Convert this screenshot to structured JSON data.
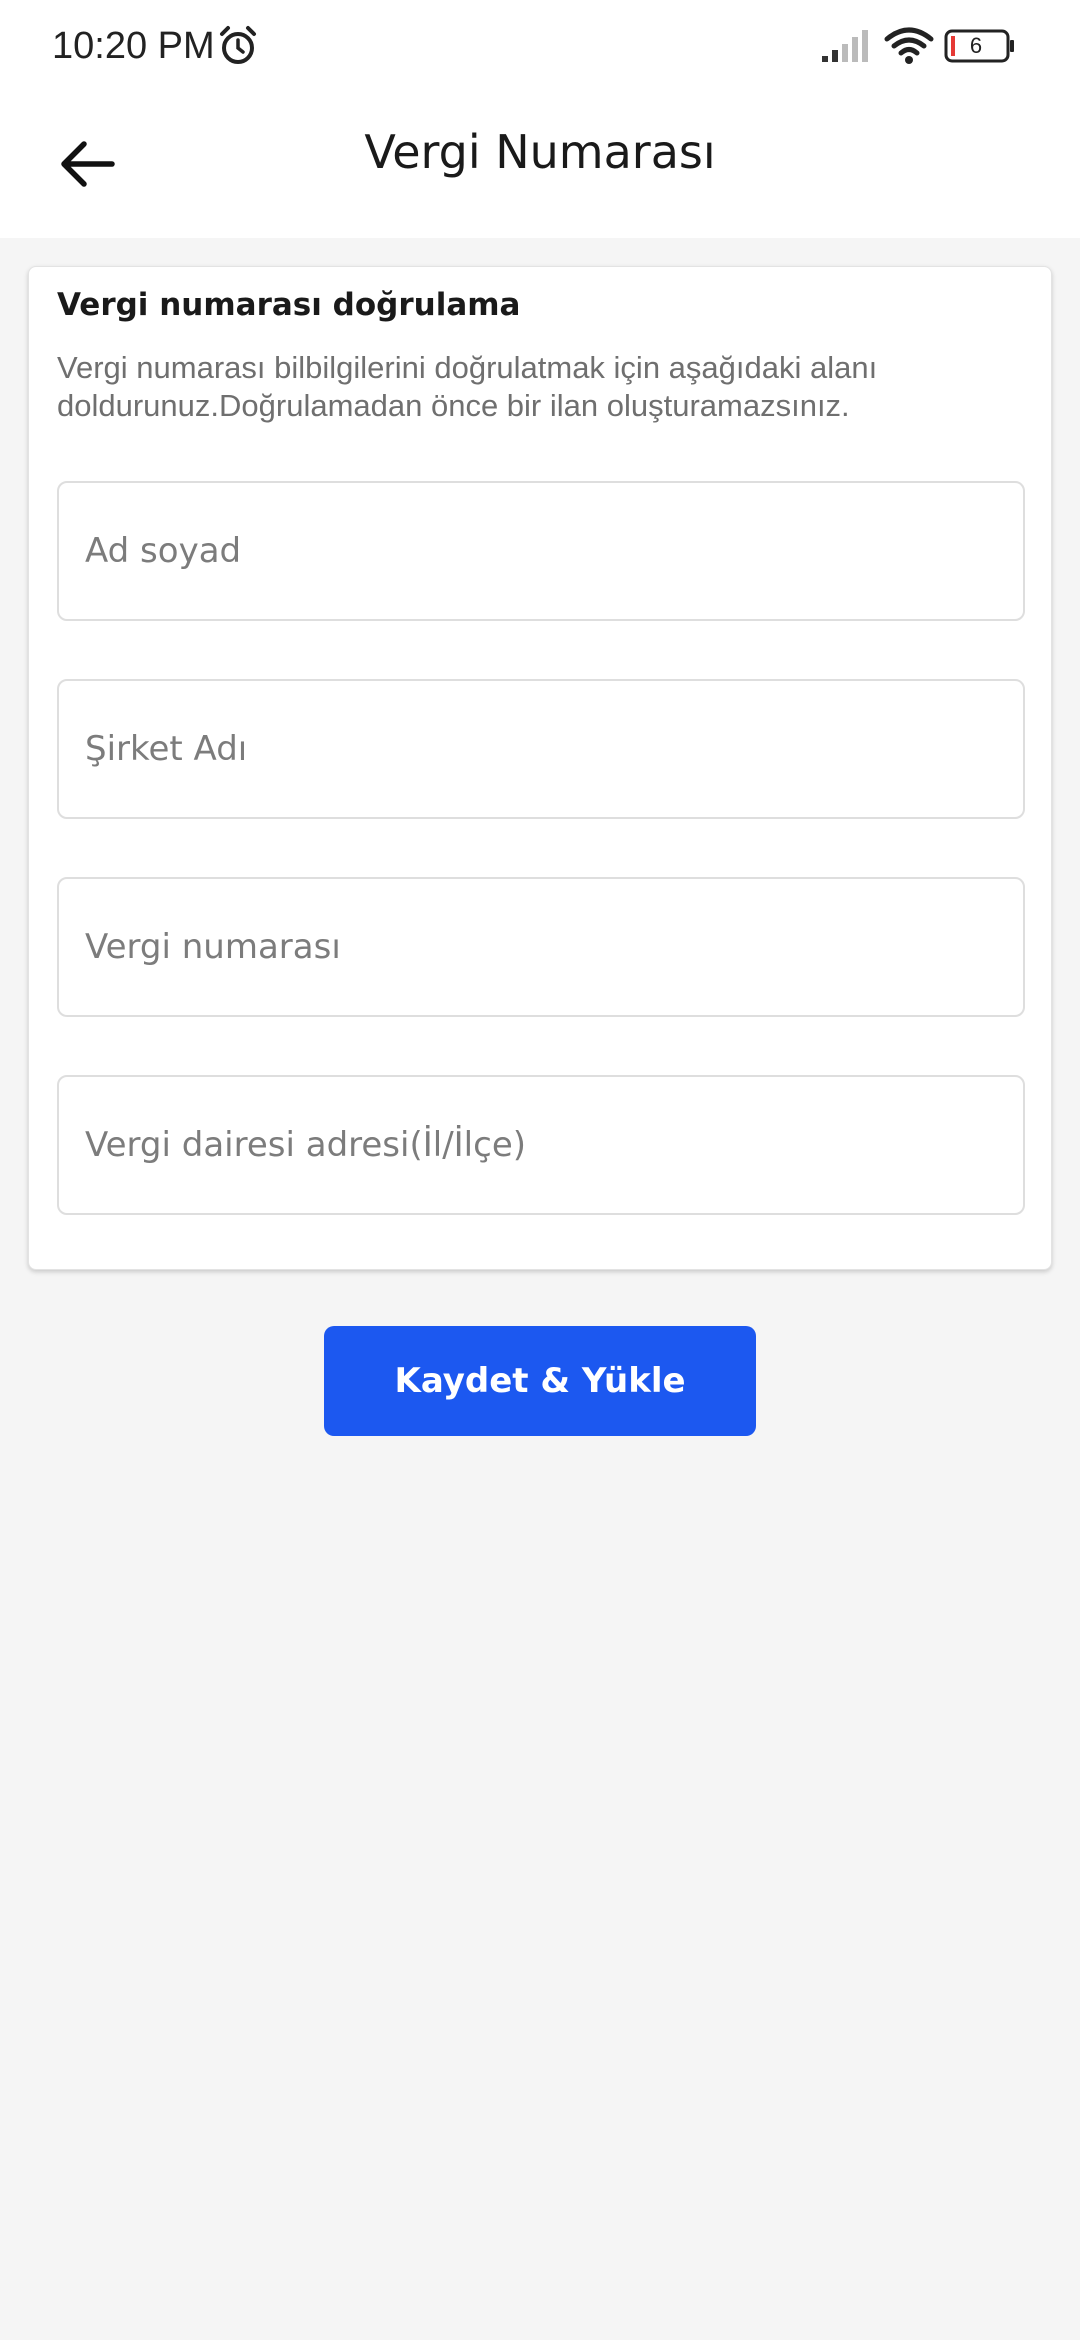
{
  "status_bar": {
    "time": "10:20 PM",
    "battery_level": "6",
    "icons": [
      "alarm-icon",
      "signal-icon",
      "wifi-icon",
      "battery-icon"
    ]
  },
  "header": {
    "title": "Vergi Numarası",
    "back_icon": "arrow-left-icon"
  },
  "verification_card": {
    "title": "Vergi numarası doğrulama",
    "description": "Vergi numarası bilbilgilerini doğrulatmak için aşağıdaki alanı doldurunuz.Doğrulamadan önce bir ilan oluşturamazsınız.",
    "fields": [
      {
        "placeholder": "Ad soyad",
        "value": ""
      },
      {
        "placeholder": "Şirket Adı",
        "value": ""
      },
      {
        "placeholder": "Vergi numarası",
        "value": ""
      },
      {
        "placeholder": "Vergi dairesi adresi(İl/İlçe)",
        "value": ""
      }
    ]
  },
  "actions": {
    "save_label": "Kaydet & Yükle"
  },
  "colors": {
    "primary": "#1c58f0",
    "background": "#f5f5f5",
    "battery_low": "#e53935"
  }
}
